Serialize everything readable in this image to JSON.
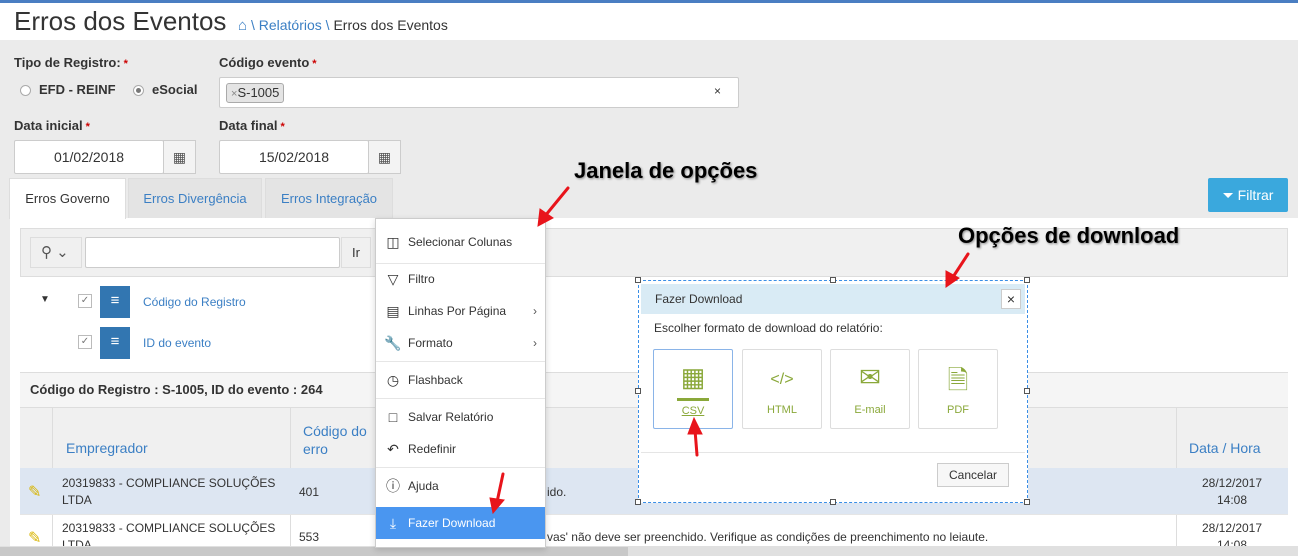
{
  "header": {
    "title": "Erros dos Eventos",
    "breadcrumb": {
      "home_icon": "home-icon",
      "sep1": "\\",
      "link": "Relatórios",
      "sep2": "\\",
      "current": "Erros dos Eventos"
    }
  },
  "form": {
    "tipo_label": "Tipo de Registro:",
    "required_mark": "*",
    "radio_options": [
      {
        "label": "EFD - REINF",
        "selected": false
      },
      {
        "label": "eSocial",
        "selected": true
      }
    ],
    "codigo_label": "Código evento",
    "codigo_tag": "S-1005",
    "tag_remove": "×",
    "clear": "×",
    "data_inicial_label": "Data inicial",
    "data_inicial": "01/02/2018",
    "data_final_label": "Data final",
    "data_final": "15/02/2018"
  },
  "tabs": [
    {
      "label": "Erros Governo",
      "active": true
    },
    {
      "label": "Erros Divergência"
    },
    {
      "label": "Erros Integração"
    }
  ],
  "filtrar_label": "Filtrar",
  "report": {
    "search_value": "",
    "go_label": "Ir",
    "groups": [
      {
        "label": "Código do Registro"
      },
      {
        "label": "ID do evento"
      }
    ],
    "break_header": "Código do Registro : S-1005, ID do evento : 264",
    "columns": [
      "Empregrador",
      "Código do erro",
      "Data / Hora"
    ],
    "rows": [
      {
        "empregador": "20319833 - COMPLIANCE SOLUÇÕES LTDA",
        "codigo": "401",
        "descricao": "ido.",
        "data": "28/12/2017",
        "hora": "14:08"
      },
      {
        "empregador": "20319833 - COMPLIANCE SOLUÇÕES LTDA",
        "codigo": "553",
        "descricao": "vas' não deve ser preenchido. Verifique as condições de preenchimento no leiaute.",
        "data": "28/12/2017",
        "hora": "14:08"
      }
    ]
  },
  "menu": {
    "items": [
      {
        "label": "Selecionar Colunas",
        "icon": "columns-icon"
      },
      {
        "label": "Filtro",
        "icon": "filter-icon"
      },
      {
        "label": "Linhas Por Página",
        "icon": "rows-icon",
        "submenu": true
      },
      {
        "label": "Formato",
        "icon": "wrench-icon",
        "submenu": true
      },
      {
        "label": "Flashback",
        "icon": "clock-icon"
      },
      {
        "label": "Salvar Relatório",
        "icon": "bookmark-icon"
      },
      {
        "label": "Redefinir",
        "icon": "reset-icon"
      },
      {
        "label": "Ajuda",
        "icon": "help-icon"
      },
      {
        "label": "Fazer Download",
        "icon": "download-icon",
        "selected": true
      }
    ]
  },
  "dialog": {
    "title": "Fazer Download",
    "close": "×",
    "prompt": "Escolher formato de download do relatório:",
    "formats": [
      {
        "label": "CSV",
        "selected": true
      },
      {
        "label": "HTML"
      },
      {
        "label": "E-mail"
      },
      {
        "label": "PDF"
      }
    ],
    "cancel_label": "Cancelar"
  },
  "annotations": {
    "menu_note": "Janela de opções",
    "download_note": "Opções de download",
    "arrow_color": "#e8141b"
  },
  "colors": {
    "accent": "#3b7fc4",
    "filter_button": "#3aa8dd",
    "selected_menu": "#4a96f0",
    "format_icon": "#8aa83a"
  }
}
